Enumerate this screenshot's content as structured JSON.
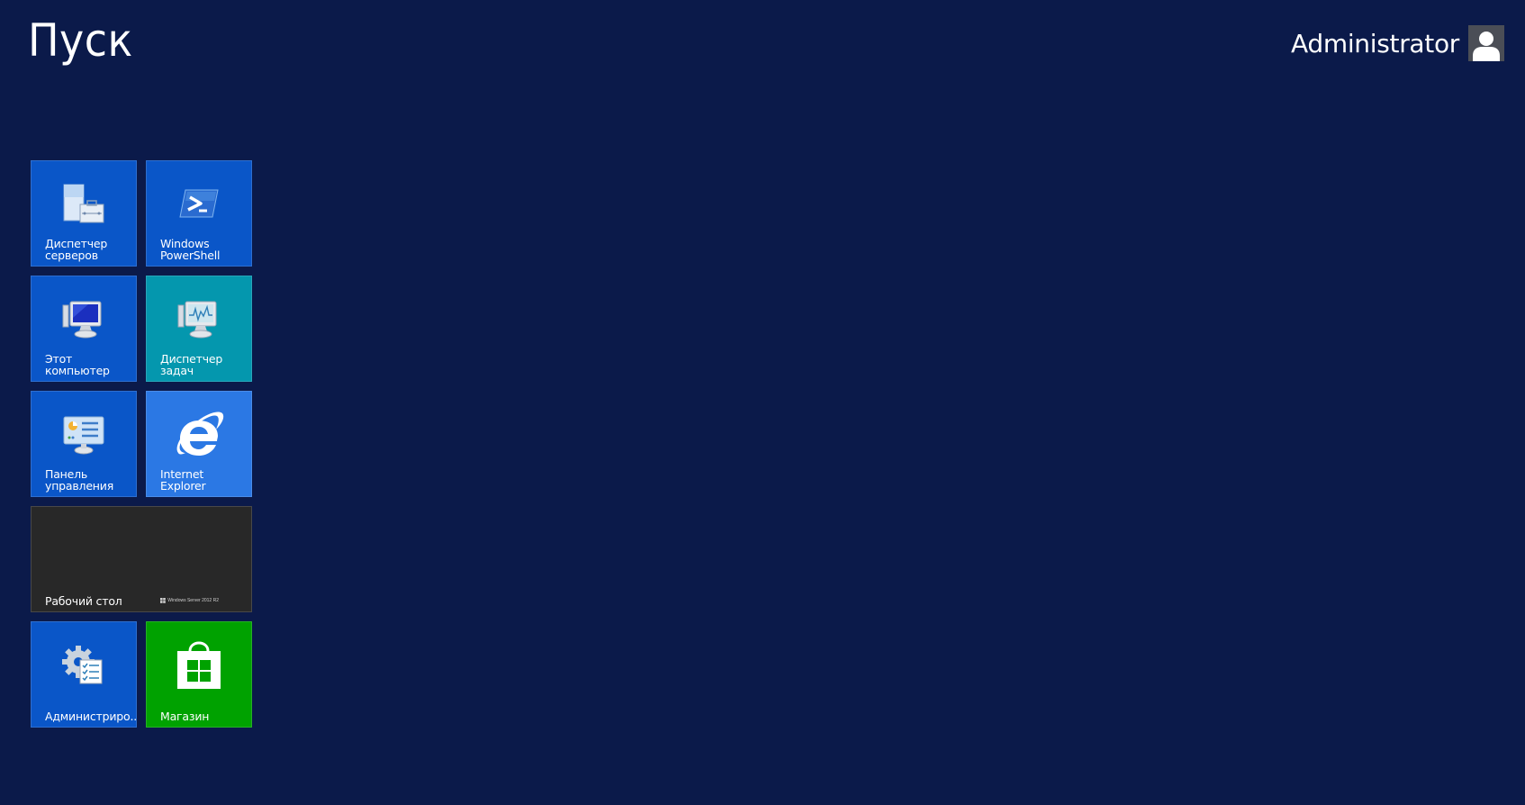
{
  "header": {
    "title": "Пуск",
    "user_name": "Administrator"
  },
  "icons": {
    "avatar": "user-avatar-icon",
    "server_manager": "server-manager-icon",
    "powershell": "powershell-icon",
    "this_pc": "computer-icon",
    "task_manager": "task-manager-icon",
    "control_panel": "control-panel-icon",
    "ie": "internet-explorer-icon",
    "admin_tools": "admin-tools-icon",
    "store": "store-icon"
  },
  "tiles": [
    {
      "id": "server-manager",
      "label": "Диспетчер\nсерверов",
      "color": "#0a56c8"
    },
    {
      "id": "powershell",
      "label": "Windows\nPowerShell",
      "color": "#0a56c8"
    },
    {
      "id": "this-pc",
      "label": "Этот компьютер",
      "color": "#0a56c8"
    },
    {
      "id": "task-manager",
      "label": "Диспетчер\nзадач",
      "color": "#0497ae"
    },
    {
      "id": "control-panel",
      "label": "Панель\nуправления",
      "color": "#0a56c8"
    },
    {
      "id": "internet-explorer",
      "label": "Internet Explorer",
      "color": "#2b78e4"
    },
    {
      "id": "desktop",
      "label": "Рабочий стол",
      "color": "#282828",
      "watermark": "Windows Server 2012 R2"
    },
    {
      "id": "admin-tools",
      "label": "Администриро...",
      "color": "#0a56c8"
    },
    {
      "id": "store",
      "label": "Магазин",
      "color": "#00a200"
    }
  ],
  "colors": {
    "background": "#0b1a4a",
    "tile_blue": "#0a56c8",
    "tile_teal": "#0497ae",
    "tile_ie": "#2b78e4",
    "tile_desktop": "#282828",
    "tile_store": "#00a200"
  }
}
